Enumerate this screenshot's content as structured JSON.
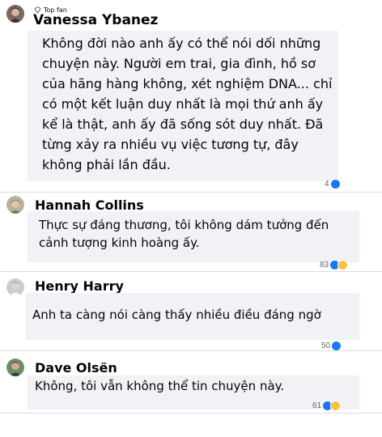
{
  "comments": [
    {
      "badge": "Top fan",
      "author": "Vanessa Ybanez",
      "lines": [
        "Không đời nào anh ấy có thể nói dối những",
        "chuyện này. Người em trai, gia đình, hồ sơ",
        "của hãng hàng không, xét nghiệm DNA... chỉ",
        "có một kết luận duy nhất là mọi thứ anh ấy",
        "kể là thật, anh ấy đã sống sót duy nhất. Đã",
        "từng xảy ra nhiều vụ việc tương tự, đây",
        "không phải lần đầu."
      ],
      "reaction_count": "4",
      "reactions": [
        "like-icon"
      ]
    },
    {
      "author": "Hannah Collins",
      "lines": [
        "Thực sự đáng thương, tôi không dám tưởng đến",
        "cảnh tượng kinh hoàng ấy."
      ],
      "reaction_count": "83",
      "reactions": [
        "like-icon",
        "haha-icon"
      ]
    },
    {
      "author": "Henry Harry",
      "lines": [
        "Anh ta càng nói càng thấy nhiều điều đáng ngờ"
      ],
      "reaction_count": "50",
      "reactions": [
        "like-icon"
      ]
    },
    {
      "author": "Dave Olsën",
      "lines": [
        "Không, tôi vẫn không thể tin chuyện này."
      ],
      "reaction_count": "61",
      "reactions": [
        "like-icon",
        "haha-icon"
      ]
    }
  ],
  "colors": {
    "bubble": "#f0f2f5",
    "like": "#1877f2",
    "haha": "#f7c33f",
    "count": "#65676b",
    "divider": "#dadde1"
  }
}
